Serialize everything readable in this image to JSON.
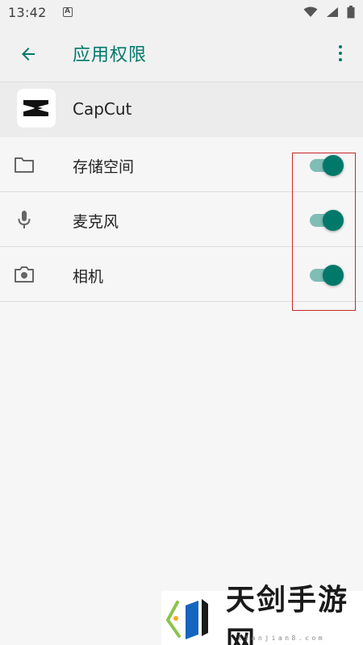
{
  "status_bar": {
    "time": "13:42",
    "notification_icon": "A"
  },
  "app_bar": {
    "title": "应用权限",
    "back_icon": "arrow-back-icon",
    "more_icon": "more-vert-icon",
    "accent": "#00796b"
  },
  "app": {
    "name": "CapCut",
    "icon": "capcut-logo-icon"
  },
  "permissions": [
    {
      "label": "存储空间",
      "icon": "folder-icon",
      "enabled": true
    },
    {
      "label": "麦克风",
      "icon": "microphone-icon",
      "enabled": true
    },
    {
      "label": "相机",
      "icon": "camera-icon",
      "enabled": true
    }
  ],
  "colors": {
    "toggle_thumb": "#00796b",
    "toggle_track": "#7fbdb5",
    "highlight": "#c62828"
  },
  "watermark": {
    "text": "天剑手游网",
    "subtext": "tianjian8.com"
  }
}
